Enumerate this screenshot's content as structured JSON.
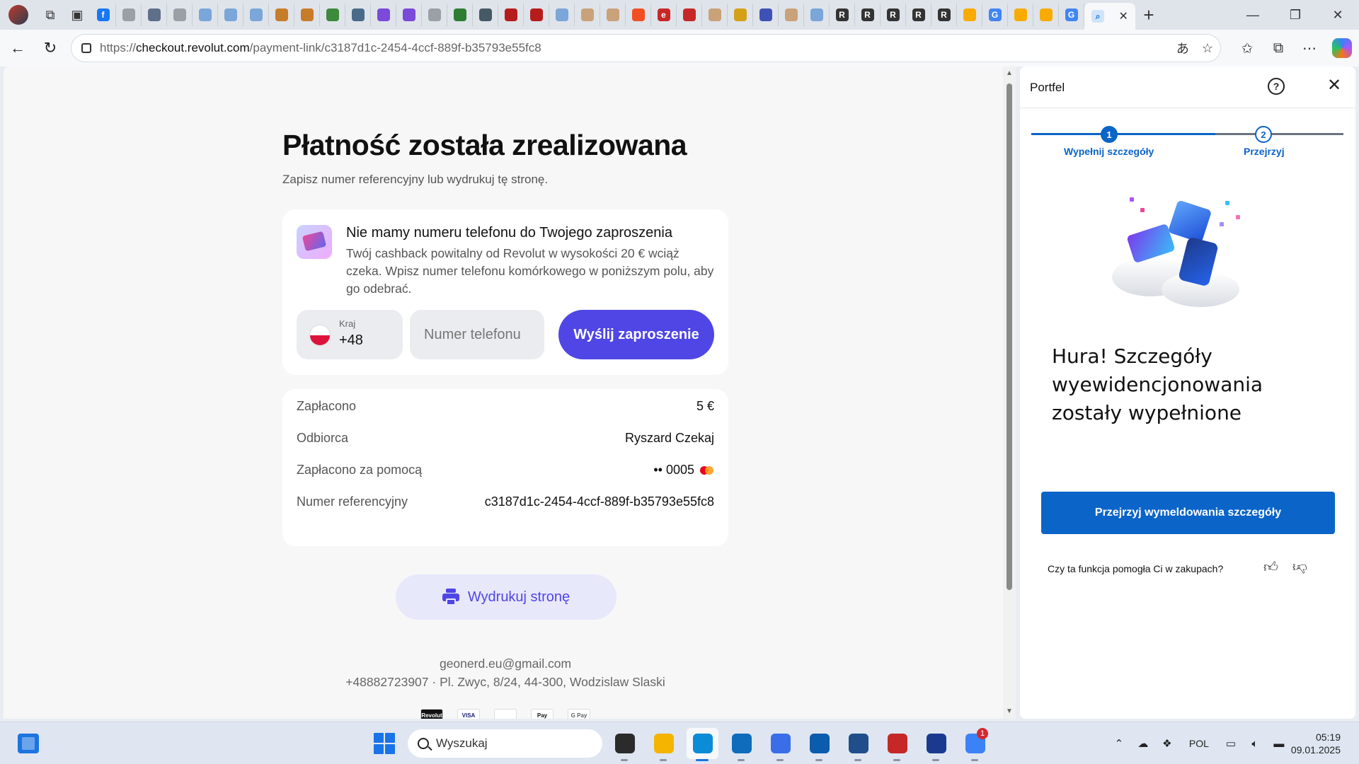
{
  "browser": {
    "url_prefix": "https://",
    "url_domain": "checkout.revolut.com",
    "url_path": "/payment-link/c3187d1c-2454-4ccf-889f-b35793e55fc8",
    "tabs": [
      {
        "icon": "facebook-icon",
        "color": "#1877f2",
        "glyph": "f"
      },
      {
        "icon": "page-icon",
        "color": "#9aa0a6",
        "glyph": ""
      },
      {
        "icon": "page-icon",
        "color": "#5f6f8a",
        "glyph": ""
      },
      {
        "icon": "page-icon",
        "color": "#9aa0a6",
        "glyph": ""
      },
      {
        "icon": "search-icon",
        "color": "#7aa6d9",
        "glyph": ""
      },
      {
        "icon": "search-icon",
        "color": "#7aa6d9",
        "glyph": ""
      },
      {
        "icon": "search-icon",
        "color": "#7aa6d9",
        "glyph": ""
      },
      {
        "icon": "app-icon",
        "color": "#c77c2a",
        "glyph": ""
      },
      {
        "icon": "app-icon",
        "color": "#c77c2a",
        "glyph": ""
      },
      {
        "icon": "app-icon",
        "color": "#3c8a3c",
        "glyph": ""
      },
      {
        "icon": "app-icon",
        "color": "#4a6a8a",
        "glyph": ""
      },
      {
        "icon": "app-icon",
        "color": "#7a4ad9",
        "glyph": ""
      },
      {
        "icon": "app-icon",
        "color": "#7a4ad9",
        "glyph": ""
      },
      {
        "icon": "page-icon",
        "color": "#9aa0a6",
        "glyph": ""
      },
      {
        "icon": "app-icon",
        "color": "#2e7d32",
        "glyph": ""
      },
      {
        "icon": "app-icon",
        "color": "#455a64",
        "glyph": ""
      },
      {
        "icon": "app-icon",
        "color": "#b71c1c",
        "glyph": ""
      },
      {
        "icon": "app-icon",
        "color": "#b71c1c",
        "glyph": ""
      },
      {
        "icon": "search-icon",
        "color": "#7aa6d9",
        "glyph": ""
      },
      {
        "icon": "app-icon",
        "color": "#c9a27a",
        "glyph": ""
      },
      {
        "icon": "app-icon",
        "color": "#c9a27a",
        "glyph": ""
      },
      {
        "icon": "microsoft-icon",
        "color": "#f25022",
        "glyph": ""
      },
      {
        "icon": "app-icon",
        "color": "#c62828",
        "glyph": "e"
      },
      {
        "icon": "app-icon",
        "color": "#c62828",
        "glyph": ""
      },
      {
        "icon": "app-icon",
        "color": "#c9a27a",
        "glyph": ""
      },
      {
        "icon": "app-icon",
        "color": "#d4a017",
        "glyph": ""
      },
      {
        "icon": "app-icon",
        "color": "#3f51b5",
        "glyph": ""
      },
      {
        "icon": "app-icon",
        "color": "#c9a27a",
        "glyph": ""
      },
      {
        "icon": "search-icon",
        "color": "#7aa6d9",
        "glyph": ""
      },
      {
        "icon": "revolut-icon",
        "color": "#333333",
        "glyph": "R"
      },
      {
        "icon": "revolut-icon",
        "color": "#333333",
        "glyph": "R"
      },
      {
        "icon": "revolut-icon",
        "color": "#333333",
        "glyph": "R"
      },
      {
        "icon": "revolut-icon",
        "color": "#333333",
        "glyph": "R"
      },
      {
        "icon": "revolut-icon",
        "color": "#333333",
        "glyph": "R"
      },
      {
        "icon": "analytics-icon",
        "color": "#f9ab00",
        "glyph": ""
      },
      {
        "icon": "google-icon",
        "color": "#4285f4",
        "glyph": "G"
      },
      {
        "icon": "analytics-icon",
        "color": "#f9ab00",
        "glyph": ""
      },
      {
        "icon": "analytics-icon",
        "color": "#f9ab00",
        "glyph": ""
      },
      {
        "icon": "google-icon",
        "color": "#4285f4",
        "glyph": "G"
      }
    ]
  },
  "page": {
    "title": "Płatność została zrealizowana",
    "subtitle": "Zapisz numer referencyjny lub wydrukuj tę stronę.",
    "invite": {
      "title": "Nie mamy numeru telefonu do Twojego zaproszenia",
      "text": "Twój cashback powitalny od Revolut w wysokości 20 € wciąż czeka. Wpisz numer telefonu komórkowego w poniższym polu, aby go odebrać.",
      "country_label": "Kraj",
      "country_code": "+48",
      "phone_placeholder": "Numer telefonu",
      "send_label": "Wyślij zaproszenie"
    },
    "details": [
      {
        "label": "Zapłacono",
        "value": "5 €"
      },
      {
        "label": "Odbiorca",
        "value": "Ryszard Czekaj"
      },
      {
        "label": "Zapłacono za pomocą",
        "value": "•• 0005"
      },
      {
        "label": "Numer referencyjny",
        "value": "c3187d1c-2454-4ccf-889f-b35793e55fc8"
      }
    ],
    "print_label": "Wydrukuj stronę",
    "footer_email": "geonerd.eu@gmail.com",
    "footer_address": "+48882723907 · Pl. Zwyc, 8/24, 44-300, Wodzislaw Slaski",
    "pay_logos": [
      {
        "name": "revolut-logo",
        "text": "Revolut",
        "bg": "#111111",
        "fg": "#ffffff"
      },
      {
        "name": "visa-logo",
        "text": "VISA",
        "bg": "#ffffff",
        "fg": "#1a1f71"
      },
      {
        "name": "mastercard-logo",
        "text": "",
        "bg": "#ffffff",
        "fg": "#eb001b"
      },
      {
        "name": "apple-pay-logo",
        "text": "Pay",
        "bg": "#ffffff",
        "fg": "#111111"
      },
      {
        "name": "google-pay-logo",
        "text": "G Pay",
        "bg": "#ffffff",
        "fg": "#5f6368"
      }
    ]
  },
  "panel": {
    "title": "Portfel",
    "steps": [
      {
        "number": "1",
        "label": "Wypełnij szczegóły"
      },
      {
        "number": "2",
        "label": "Przejrzyj"
      }
    ],
    "headline": "Hura! Szczegóły wyewidencjonowania zostały wypełnione",
    "review_button": "Przejrzyj wymeldowania szczegóły",
    "feedback_question": "Czy ta funkcja pomogła Ci w zakupach?"
  },
  "taskbar": {
    "search_placeholder": "Wyszukaj",
    "apps": [
      {
        "name": "task-view-icon",
        "color": "#2b2b2b"
      },
      {
        "name": "file-explorer-icon",
        "color": "#f4b400"
      },
      {
        "name": "edge-icon",
        "color": "#0c8bd6",
        "active": true
      },
      {
        "name": "outlook-icon",
        "color": "#0f6cbd"
      },
      {
        "name": "store-icon",
        "color": "#3a6ee8"
      },
      {
        "name": "defender-icon",
        "color": "#0b5cad"
      },
      {
        "name": "virtualbox-icon",
        "color": "#1f4e8a"
      },
      {
        "name": "screen-recorder-icon",
        "color": "#c62828"
      },
      {
        "name": "save-app-icon",
        "color": "#1b3a8f"
      },
      {
        "name": "messenger-icon",
        "color": "#3b82f6",
        "badge": "1"
      }
    ],
    "language": "POL",
    "time": "05:19",
    "date": "09.01.2025"
  }
}
